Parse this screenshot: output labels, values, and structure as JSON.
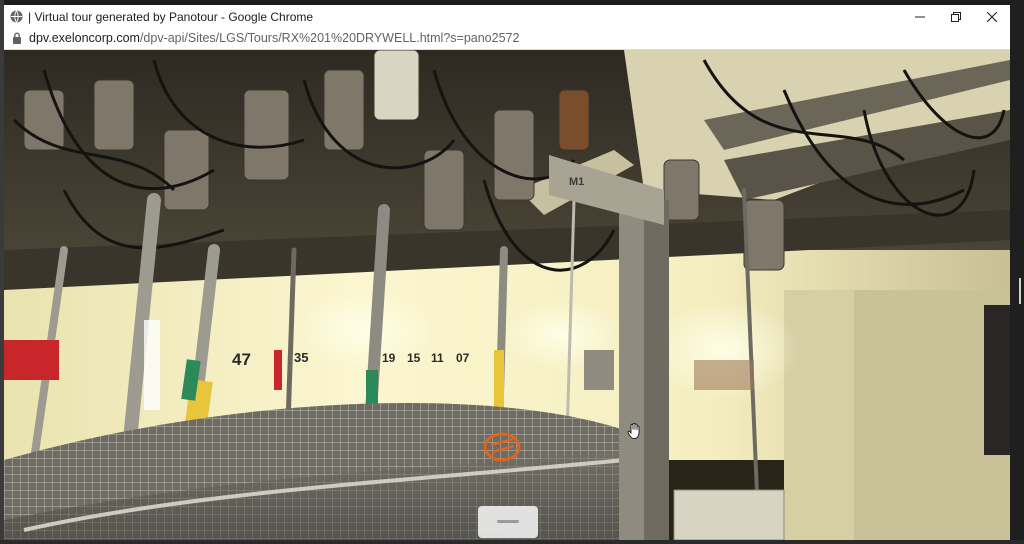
{
  "window": {
    "title": "| Virtual tour generated by Panotour - Google Chrome"
  },
  "address_bar": {
    "domain": "dpv.exeloncorp.com",
    "path": "/dpv-api/Sites/LGS/Tours/RX%201%20DRYWELL.html?s=pano2572"
  },
  "icons": {
    "favicon": "globe-icon",
    "lock": "lock-icon",
    "minimize": "minimize-icon",
    "restore": "restore-icon",
    "close": "close-icon",
    "cursor": "hand-cursor-icon"
  },
  "scene": {
    "labels": [
      "47",
      "35",
      "19",
      "15",
      "11",
      "07",
      "M1"
    ]
  },
  "colors": {
    "hotspot": "#e0641e",
    "yellow_pipe": "#e8c53a"
  }
}
